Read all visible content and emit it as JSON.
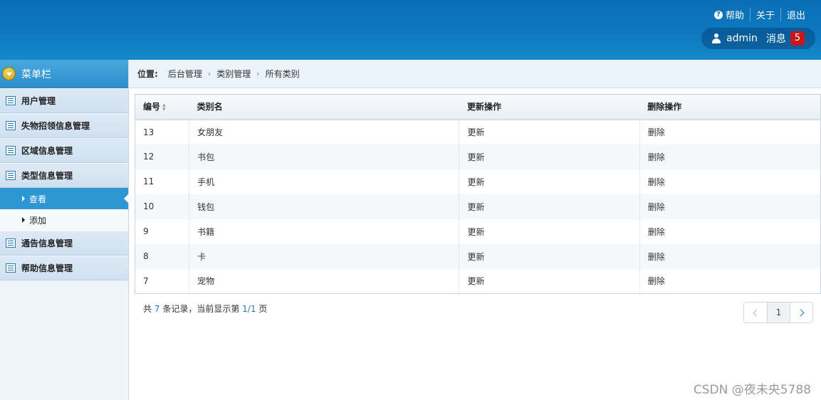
{
  "header": {
    "help": "帮助",
    "about": "关于",
    "logout": "退出",
    "username": "admin",
    "messages_label": "消息",
    "messages_count": "5"
  },
  "sidebar": {
    "title": "菜单栏",
    "items": [
      {
        "label": "用户管理"
      },
      {
        "label": "失物招领信息管理"
      },
      {
        "label": "区域信息管理"
      },
      {
        "label": "类型信息管理"
      },
      {
        "label": "通告信息管理"
      },
      {
        "label": "帮助信息管理"
      }
    ],
    "subitems": [
      {
        "label": "查看"
      },
      {
        "label": "添加"
      }
    ]
  },
  "breadcrumb": {
    "label": "位置:",
    "items": [
      "后台管理",
      "类别管理",
      "所有类别"
    ]
  },
  "table": {
    "headers": [
      "编号",
      "类别名",
      "更新操作",
      "删除操作"
    ],
    "rows": [
      {
        "id": "13",
        "name": "女朋友",
        "update": "更新",
        "delete": "删除"
      },
      {
        "id": "12",
        "name": "书包",
        "update": "更新",
        "delete": "删除"
      },
      {
        "id": "11",
        "name": "手机",
        "update": "更新",
        "delete": "删除"
      },
      {
        "id": "10",
        "name": "钱包",
        "update": "更新",
        "delete": "删除"
      },
      {
        "id": "9",
        "name": "书籍",
        "update": "更新",
        "delete": "删除"
      },
      {
        "id": "8",
        "name": "卡",
        "update": "更新",
        "delete": "删除"
      },
      {
        "id": "7",
        "name": "宠物",
        "update": "更新",
        "delete": "删除"
      }
    ]
  },
  "footer": {
    "prefix": "共",
    "total": "7",
    "middle": "条记录，当前显示第",
    "page": "1/1",
    "suffix": "页"
  },
  "pager": {
    "current": "1"
  },
  "watermark": "CSDN @夜未央5788",
  "colors": {
    "header_blue": "#0b6fb5",
    "accent": "#2d97d4",
    "delete_red": "#d01c1c",
    "badge_red": "#c8171b"
  }
}
